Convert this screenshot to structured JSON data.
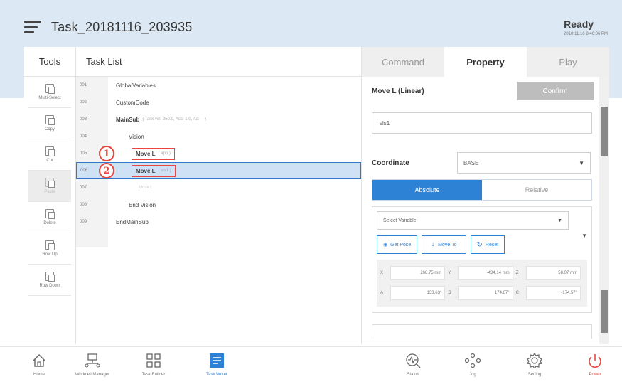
{
  "header": {
    "task_title": "Task_20181116_203935",
    "status": "Ready",
    "datetime": "2018.11.16 8:46:06 PM"
  },
  "tools": {
    "title": "Tools",
    "items": [
      {
        "label": "Multi-Select",
        "icon": "multi-select-icon",
        "enabled": true
      },
      {
        "label": "Copy",
        "icon": "copy-icon",
        "enabled": true
      },
      {
        "label": "Cut",
        "icon": "cut-icon",
        "enabled": true
      },
      {
        "label": "Paste",
        "icon": "paste-icon",
        "enabled": false
      },
      {
        "label": "Delete",
        "icon": "trash-icon",
        "enabled": true
      },
      {
        "label": "Row Up",
        "icon": "row-up-icon",
        "enabled": true
      },
      {
        "label": "Row Down",
        "icon": "row-down-icon",
        "enabled": true
      }
    ]
  },
  "tasklist": {
    "title": "Task List",
    "rows": [
      {
        "num": "001",
        "text": "GlobalVariables",
        "sub": ""
      },
      {
        "num": "002",
        "text": "CustomCode",
        "sub": ""
      },
      {
        "num": "003",
        "text": "MainSub",
        "sub": "( Task vel: 250.0, Acc: 1.0, Ao: -- )"
      },
      {
        "num": "004",
        "text": "Vision",
        "sub": ""
      },
      {
        "num": "005",
        "text": "Move L",
        "sub": "( app )"
      },
      {
        "num": "006",
        "text": "Move L",
        "sub": "( vis1 )"
      },
      {
        "num": "007",
        "text": "",
        "sub": "Move L"
      },
      {
        "num": "008",
        "text": "End Vision",
        "sub": ""
      },
      {
        "num": "009",
        "text": "EndMainSub",
        "sub": ""
      }
    ],
    "badges": [
      "1",
      "2"
    ]
  },
  "panel": {
    "tabs": [
      "Command",
      "Property",
      "Play"
    ],
    "active_tab": "Property",
    "command_title": "Move L (Linear)",
    "confirm_label": "Confirm",
    "name_value": "vis1",
    "coordinate_label": "Coordinate",
    "coordinate_value": "BASE",
    "toggle": [
      "Absolute",
      "Relative"
    ],
    "select_variable": "Select Variable",
    "buttons": {
      "get_pose": "Get Pose",
      "move_to": "Move To",
      "reset": "Reset"
    },
    "pose": [
      {
        "key": "X",
        "value": "268.75 mm"
      },
      {
        "key": "Y",
        "value": "-434.14 mm"
      },
      {
        "key": "Z",
        "value": "58.07 mm"
      },
      {
        "key": "A",
        "value": "133.63°"
      },
      {
        "key": "B",
        "value": "174.07°"
      },
      {
        "key": "C",
        "value": "-174.57°"
      }
    ]
  },
  "bottom_nav": [
    {
      "label": "Home",
      "icon": "home-icon"
    },
    {
      "label": "Workcell Manager",
      "icon": "workcell-icon"
    },
    {
      "label": "Task Builder",
      "icon": "task-builder-icon"
    },
    {
      "label": "Task Writer",
      "icon": "task-writer-icon"
    },
    {
      "label": "Status",
      "icon": "status-icon"
    },
    {
      "label": "Jog",
      "icon": "jog-icon"
    },
    {
      "label": "Setting",
      "icon": "gear-icon"
    },
    {
      "label": "Power",
      "icon": "power-icon"
    }
  ],
  "colors": {
    "accent": "#2d82d6",
    "highlight": "#e8473f",
    "header_bg": "#dce8f3"
  }
}
